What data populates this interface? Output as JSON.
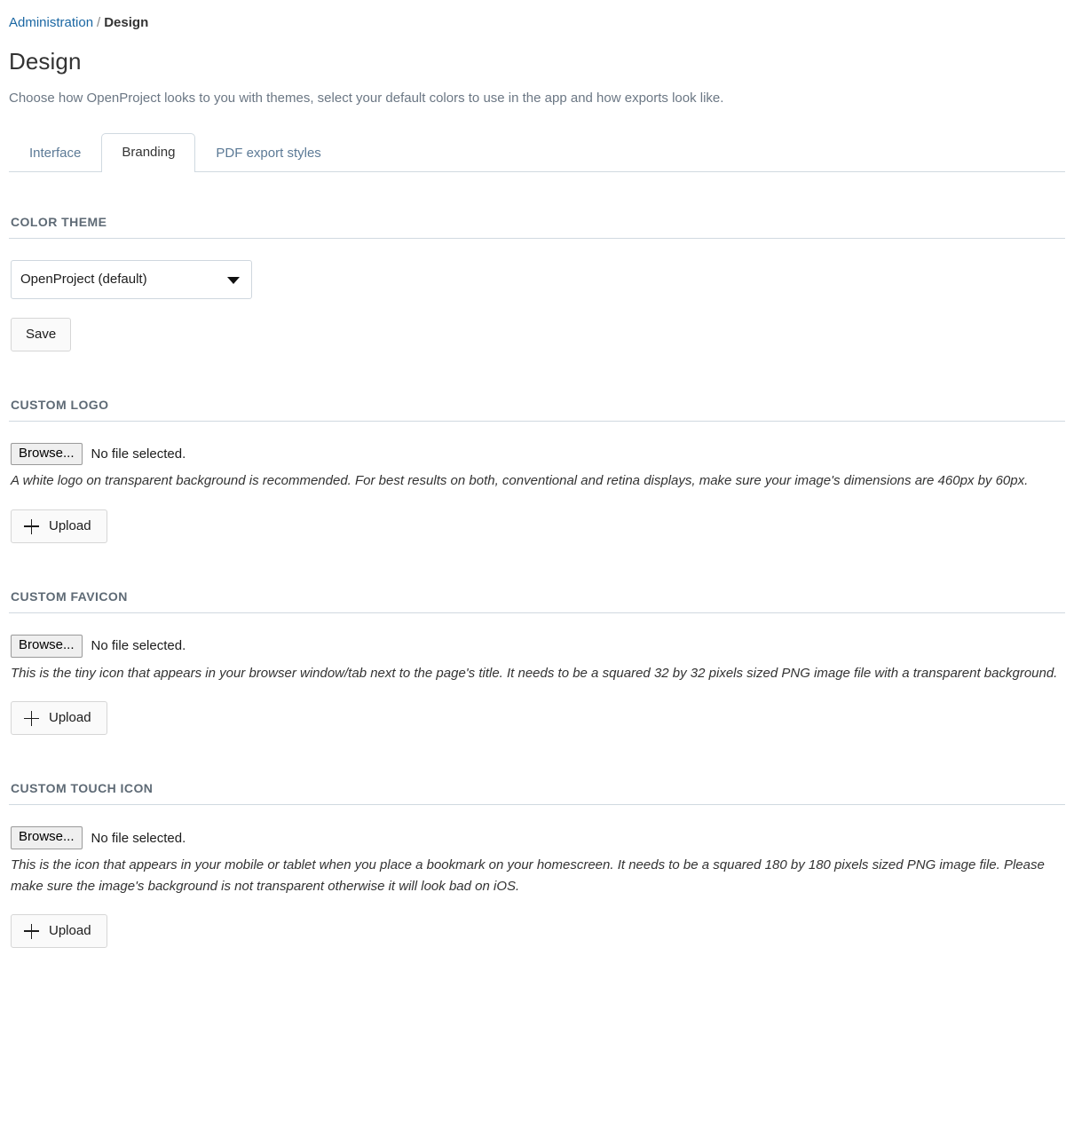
{
  "breadcrumb": {
    "parent": "Administration",
    "separator": "/",
    "current": "Design"
  },
  "header": {
    "title": "Design",
    "subtitle": "Choose how OpenProject looks to you with themes, select your default colors to use in the app and how exports look like."
  },
  "tabs": [
    {
      "label": "Interface",
      "active": false
    },
    {
      "label": "Branding",
      "active": true
    },
    {
      "label": "PDF export styles",
      "active": false
    }
  ],
  "color_theme": {
    "section_title": "COLOR THEME",
    "selected": "OpenProject (default)",
    "options": [
      "OpenProject (default)"
    ],
    "save_label": "Save",
    "dropdown_icon": "chevron-down-icon"
  },
  "custom_logo": {
    "section_title": "CUSTOM LOGO",
    "browse_label": "Browse...",
    "file_status": "No file selected.",
    "hint": "A white logo on transparent background is recommended. For best results on both, conventional and retina displays, make sure your image's dimensions are 460px by 60px.",
    "upload_label": "Upload",
    "upload_icon": "plus-icon"
  },
  "custom_favicon": {
    "section_title": "CUSTOM FAVICON",
    "browse_label": "Browse...",
    "file_status": "No file selected.",
    "hint": "This is the tiny icon that appears in your browser window/tab next to the page's title. It needs to be a squared 32 by 32 pixels sized PNG image file with a transparent background.",
    "upload_label": "Upload",
    "upload_icon": "plus-icon"
  },
  "custom_touch_icon": {
    "section_title": "CUSTOM TOUCH ICON",
    "browse_label": "Browse...",
    "file_status": "No file selected.",
    "hint": "This is the icon that appears in your mobile or tablet when you place a bookmark on your homescreen. It needs to be a squared 180 by 180 pixels sized PNG image file. Please make sure the image's background is not transparent otherwise it will look bad on iOS.",
    "upload_label": "Upload",
    "upload_icon": "plus-icon"
  },
  "colors": {
    "link": "#1a67a3",
    "rule": "#d0d9e0",
    "section_heading": "#5e6a75",
    "subtitle": "#6b7784",
    "tab_inactive": "#5c7a96"
  }
}
